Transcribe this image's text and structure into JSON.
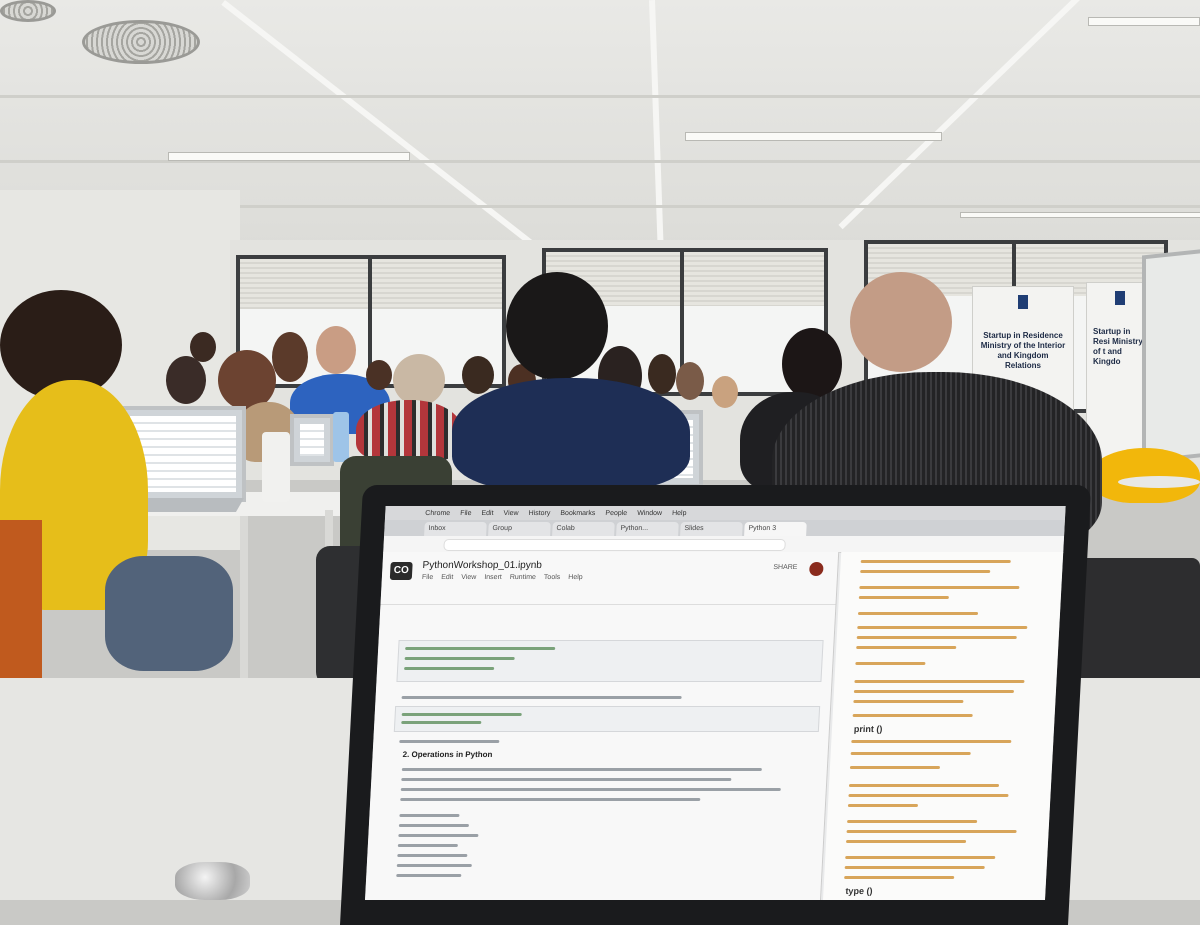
{
  "scene": {
    "banner_left": "Startup in Residence Ministry of the Interior and Kingdom Relations",
    "banner_right": "Startup in Resi Ministry of t and Kingdo"
  },
  "laptop": {
    "menubar_items": [
      "Chrome",
      "File",
      "Edit",
      "View",
      "History",
      "Bookmarks",
      "People",
      "Window",
      "Help"
    ],
    "tabs": [
      "Inbox",
      "Group",
      "Colab",
      "Python...",
      "Slides",
      "Python 3"
    ],
    "notebook_name": "PythonWorkshop_01.ipynb",
    "menu_items": [
      "File",
      "Edit",
      "View",
      "Insert",
      "Runtime",
      "Tools",
      "Help"
    ],
    "share_label": "SHARE",
    "logo": "CO",
    "section_heading": "2. Operations in Python",
    "print_label": "print ()",
    "type_label": "type ()"
  }
}
